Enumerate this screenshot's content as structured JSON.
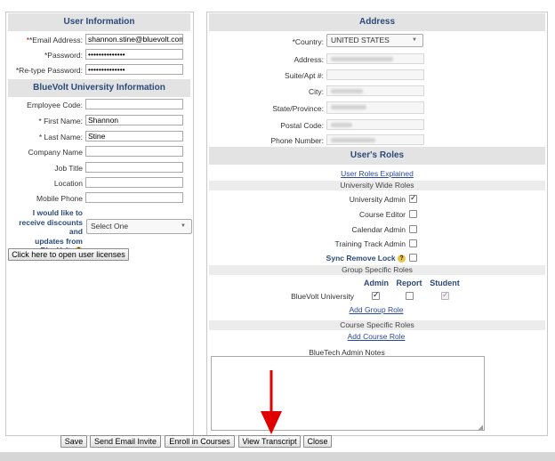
{
  "user_info": {
    "header": "User Information",
    "email_label": "*Email Address:",
    "email_value": "shannon.stine@bluevolt.com",
    "password_label": "*Password:",
    "password_value": "••••••••••••••",
    "retype_label": "*Re-type Password:",
    "retype_value": "••••••••••••••"
  },
  "university_info": {
    "header": "BlueVolt University Information",
    "employee_code_label": "Employee Code:",
    "first_name_label": "* First Name:",
    "first_name_value": "Shannon",
    "last_name_label": "* Last Name:",
    "last_name_value": "Stine",
    "company_label": "Company Name",
    "job_title_label": "Job Title",
    "location_label": "Location",
    "mobile_label": "Mobile Phone",
    "discount_label_1": "I would like to",
    "discount_label_2": "receive discounts and",
    "discount_label_3": "updates from",
    "discount_label_4": "BlueVolt.",
    "discount_select": "Select One",
    "licenses_button": "Click here to open user licenses"
  },
  "address": {
    "header": "Address",
    "country_label": "*Country:",
    "country_value": "UNITED STATES",
    "address_label": "Address:",
    "suite_label": "Suite/Apt #:",
    "city_label": "City:",
    "state_label": "State/Province:",
    "postal_label": "Postal Code:",
    "phone_label": "Phone Number:"
  },
  "roles": {
    "header": "User's Roles",
    "explained_link": "User Roles Explained",
    "university_wide": "University Wide Roles",
    "university_admin": "University Admin",
    "course_editor": "Course Editor",
    "calendar_admin": "Calendar Admin",
    "training_track_admin": "Training Track Admin",
    "sync_remove_lock": "Sync Remove Lock",
    "group_specific": "Group Specific Roles",
    "col_admin": "Admin",
    "col_report": "Report",
    "col_student": "Student",
    "group_name": "BlueVolt University",
    "add_group_role": "Add Group Role",
    "course_specific": "Course Specific Roles",
    "add_course_role": "Add Course Role",
    "notes_label": "BlueTech Admin Notes"
  },
  "footer_buttons": {
    "save": "Save",
    "send_email": "Send Email Invite",
    "enroll": "Enroll in Courses",
    "view_transcript": "View Transcript",
    "close": "Close"
  },
  "icons": {
    "help": "help-icon",
    "annotation": "red-arrow-icon"
  },
  "colors": {
    "header_text": "#2a4a7a",
    "required": "#cc0000",
    "link": "#2a4aa0",
    "arrow": "#e00000"
  }
}
